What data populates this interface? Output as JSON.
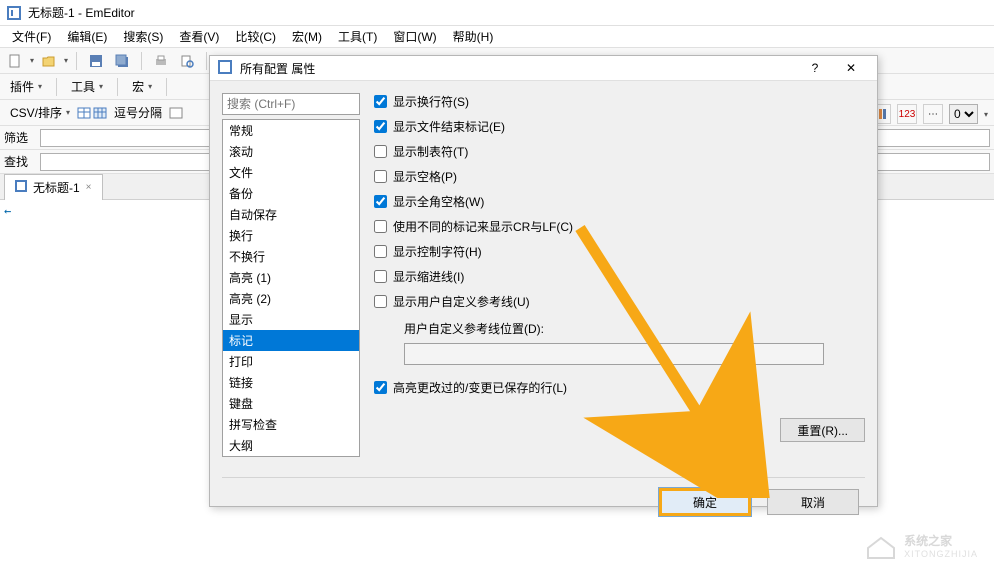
{
  "titlebar": {
    "text": "无标题-1 - EmEditor"
  },
  "menubar": [
    "文件(F)",
    "编辑(E)",
    "搜索(S)",
    "查看(V)",
    "比较(C)",
    "宏(M)",
    "工具(T)",
    "窗口(W)",
    "帮助(H)"
  ],
  "toolbar_labels": {
    "plugins": "插件",
    "tools": "工具",
    "macro": "宏"
  },
  "csv_row": {
    "label": "CSV/排序",
    "comma": "逗号分隔"
  },
  "filter_row": {
    "label": "筛选"
  },
  "find_row": {
    "label": "查找"
  },
  "right_toolbar": {
    "num_label": "123",
    "zero": "0"
  },
  "tab": {
    "name": "无标题-1",
    "close": "×"
  },
  "editor": {
    "eof_marker": "←"
  },
  "dialog": {
    "title": "所有配置 属性",
    "help": "?",
    "close": "✕",
    "search_placeholder": "搜索 (Ctrl+F)",
    "list_items": [
      "常规",
      "滚动",
      "文件",
      "备份",
      "自动保存",
      "换行",
      "不换行",
      "高亮 (1)",
      "高亮 (2)",
      "显示",
      "标记",
      "打印",
      "链接",
      "键盘",
      "拼写检查",
      "大纲"
    ],
    "selected_index": 10,
    "checkboxes": [
      {
        "label": "显示换行符(S)",
        "checked": true
      },
      {
        "label": "显示文件结束标记(E)",
        "checked": true
      },
      {
        "label": "显示制表符(T)",
        "checked": false
      },
      {
        "label": "显示空格(P)",
        "checked": false
      },
      {
        "label": "显示全角空格(W)",
        "checked": true
      },
      {
        "label": "使用不同的标记来显示CR与LF(C)",
        "checked": false
      },
      {
        "label": "显示控制字符(H)",
        "checked": false
      },
      {
        "label": "显示缩进线(I)",
        "checked": false
      },
      {
        "label": "显示用户自定义参考线(U)",
        "checked": false
      }
    ],
    "guide_label": "用户自定义参考线位置(D):",
    "guide_value": "",
    "last_checkbox": {
      "label": "高亮更改过的/变更已保存的行(L)",
      "checked": true
    },
    "reset_btn": "重置(R)...",
    "ok_btn": "确定",
    "cancel_btn": "取消"
  },
  "watermark": {
    "text": "系统之家",
    "sub": "XITONGZHIJIA"
  }
}
